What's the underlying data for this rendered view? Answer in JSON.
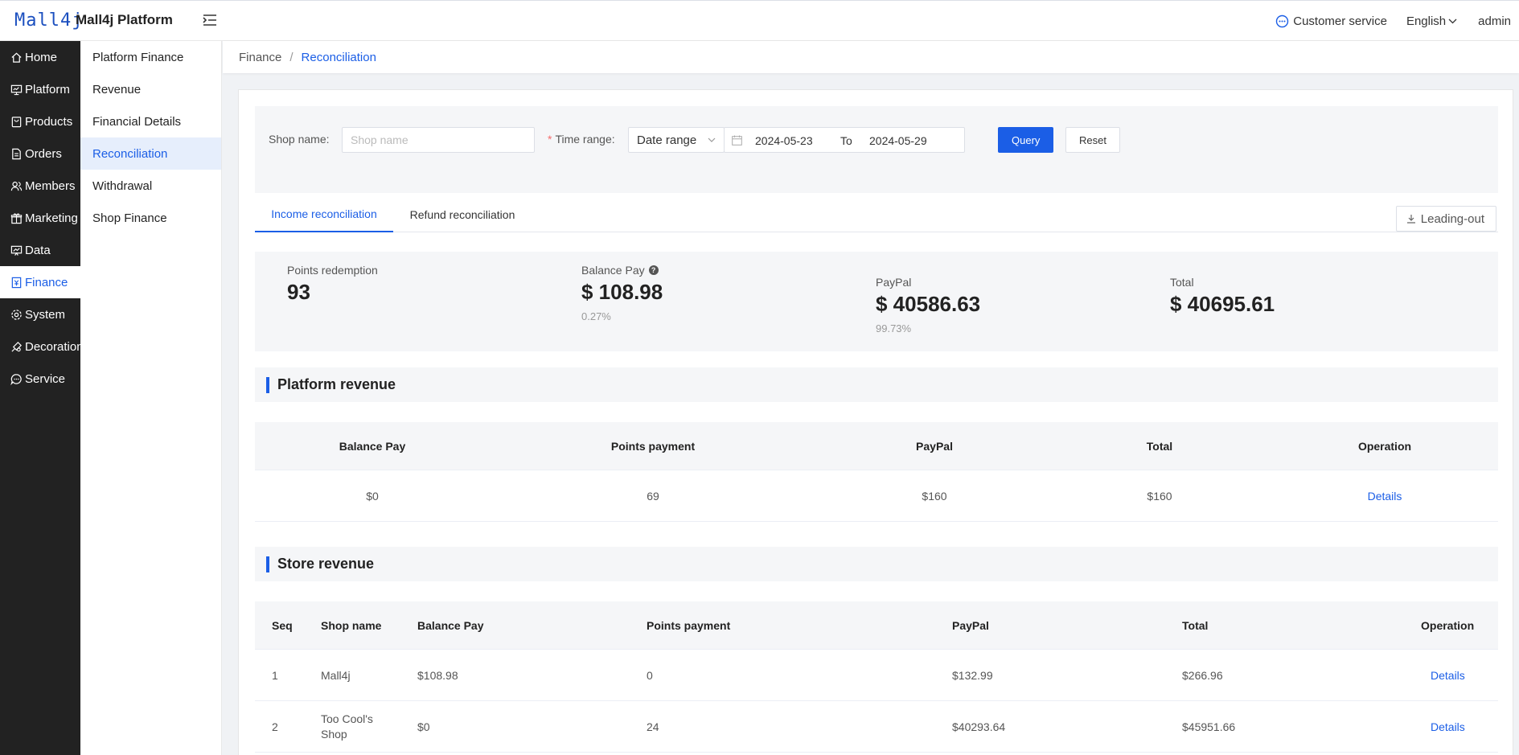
{
  "header": {
    "logo": "Mall4j",
    "app_title": "Mall4j Platform",
    "customer_service": "Customer service",
    "language": "English",
    "user": "admin"
  },
  "sidebar": {
    "items": [
      {
        "label": "Home",
        "icon": "home-icon"
      },
      {
        "label": "Platform",
        "icon": "monitor-icon"
      },
      {
        "label": "Products",
        "icon": "bag-icon"
      },
      {
        "label": "Orders",
        "icon": "document-icon"
      },
      {
        "label": "Members",
        "icon": "users-icon"
      },
      {
        "label": "Marketing",
        "icon": "gift-icon"
      },
      {
        "label": "Data",
        "icon": "chart-icon"
      },
      {
        "label": "Finance",
        "icon": "finance-icon"
      },
      {
        "label": "System",
        "icon": "gear-icon"
      },
      {
        "label": "Decoration",
        "icon": "palette-icon"
      },
      {
        "label": "Service",
        "icon": "chat-icon"
      }
    ],
    "active": "Finance"
  },
  "submenu": {
    "items": [
      "Platform Finance",
      "Revenue",
      "Financial Details",
      "Reconciliation",
      "Withdrawal",
      "Shop Finance"
    ],
    "active": "Reconciliation"
  },
  "breadcrumb": {
    "parent": "Finance",
    "separator": "/",
    "current": "Reconciliation"
  },
  "filter": {
    "shop_name_label": "Shop name:",
    "shop_name_placeholder": "Shop name",
    "shop_name_value": "",
    "required_mark": "*",
    "time_range_label": "Time range:",
    "time_range_type": "Date range",
    "start_date": "2024-05-23",
    "to_label": "To",
    "end_date": "2024-05-29",
    "query_label": "Query",
    "reset_label": "Reset"
  },
  "tabs": {
    "items": [
      "Income reconciliation",
      "Refund reconciliation"
    ],
    "active": "Income reconciliation"
  },
  "export_label": "Leading-out",
  "summary": {
    "points": {
      "label": "Points redemption",
      "value": "93"
    },
    "balance": {
      "label": "Balance Pay",
      "help": "?",
      "value": "$ 108.98",
      "percent": "0.27%"
    },
    "paypal": {
      "label": "PayPal",
      "value": "$ 40586.63",
      "percent": "99.73%"
    },
    "total": {
      "label": "Total",
      "value": "$ 40695.61"
    }
  },
  "platform_revenue": {
    "title": "Platform revenue",
    "columns": [
      "Balance Pay",
      "Points payment",
      "PayPal",
      "Total",
      "Operation"
    ],
    "rows": [
      {
        "balance": "$0",
        "points": "69",
        "paypal": "$160",
        "total": "$160",
        "operation": "Details"
      }
    ]
  },
  "store_revenue": {
    "title": "Store revenue",
    "columns": [
      "Seq",
      "Shop name",
      "Balance Pay",
      "Points payment",
      "PayPal",
      "Total",
      "Operation"
    ],
    "rows": [
      {
        "seq": "1",
        "shop": "Mall4j",
        "balance": "$108.98",
        "points": "0",
        "paypal": "$132.99",
        "total": "$266.96",
        "operation": "Details"
      },
      {
        "seq": "2",
        "shop": "Too Cool's Shop",
        "balance": "$0",
        "points": "24",
        "paypal": "$40293.64",
        "total": "$45951.66",
        "operation": "Details"
      }
    ]
  },
  "colors": {
    "accent": "#1b5ee6",
    "sidebar_bg": "#222222",
    "required": "#f56c6c"
  }
}
